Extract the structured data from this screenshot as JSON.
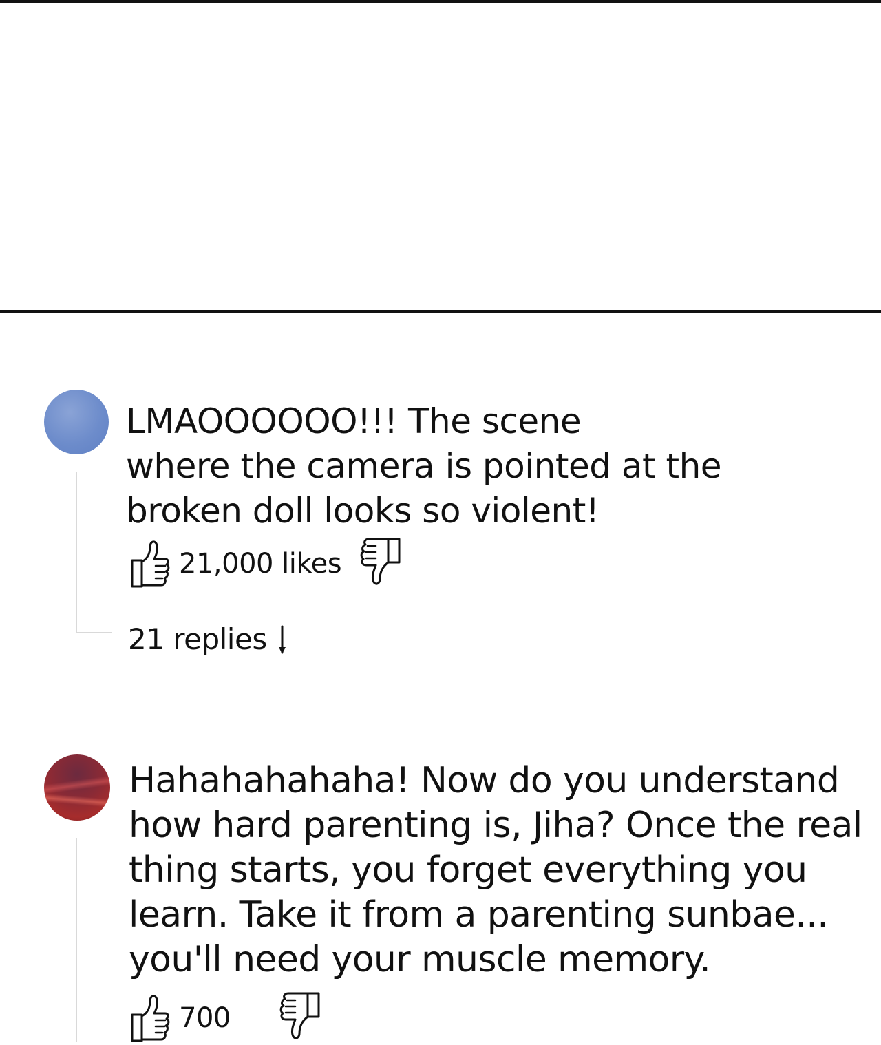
{
  "comments": [
    {
      "text": "LMAOOOOOO!!! The scene\nwhere the camera is pointed at the\nbroken doll looks so violent!",
      "likes": "21,000 likes",
      "replies": "21 replies",
      "avatar_color": "#6d8ccb"
    },
    {
      "text": "Hahahahahaha! Now do you understand\nhow hard parenting is, Jiha? Once the real\nthing starts, you forget everything you\nlearn. Take it from a parenting sunbae...\nyou'll need your muscle memory.",
      "likes": "700",
      "avatar_color": "#8b2a35"
    }
  ],
  "icons": {
    "like": "thumbs-up-icon",
    "dislike": "thumbs-down-icon",
    "expand": "arrow-down-icon"
  }
}
